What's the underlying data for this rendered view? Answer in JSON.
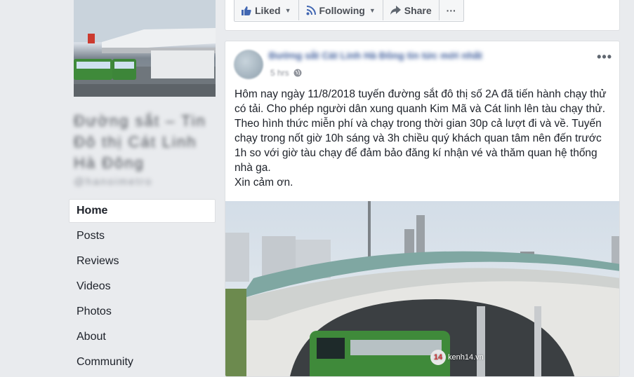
{
  "action_bar": {
    "liked_label": "Liked",
    "following_label": "Following",
    "share_label": "Share",
    "more_label": "···"
  },
  "page": {
    "name_blurred": "Đường sắt – Tin Đô thị Cát Linh Hà Đông",
    "handle_blurred": "@hanoimetro"
  },
  "nav": {
    "items": [
      {
        "label": "Home",
        "active": true
      },
      {
        "label": "Posts"
      },
      {
        "label": "Reviews"
      },
      {
        "label": "Videos"
      },
      {
        "label": "Photos"
      },
      {
        "label": "About"
      },
      {
        "label": "Community"
      }
    ]
  },
  "post": {
    "author_blurred": "Đường sắt Cát Linh Hà Đông tin tức mới nhất",
    "time": "5 hrs",
    "more": "•••",
    "paragraphs": [
      "Hôm nay ngày 11/8/2018 tuyến đường sắt đô thị số 2A đã tiến hành chạy thử có tải. Cho phép người dân xung quanh Kim Mã và Cát linh lên tàu chạy thử. Theo hình thức miễn phí và chạy trong thời gian 30p cả lượt đi và về. Tuyến chạy trong nốt giờ 10h sáng và 3h chiều quý khách quan tâm nên đến trước 1h so với giờ tàu chạy để đảm bảo đăng kí nhận vé và thăm quan hệ thống nhà ga.",
      "Xin cảm ơn."
    ],
    "watermark": "kenh14.vn",
    "watermark_badge": "14"
  },
  "colors": {
    "background": "#e9ebee",
    "link": "#385898",
    "icon_blue": "#4267b2",
    "train_green": "#3f8a3a"
  }
}
